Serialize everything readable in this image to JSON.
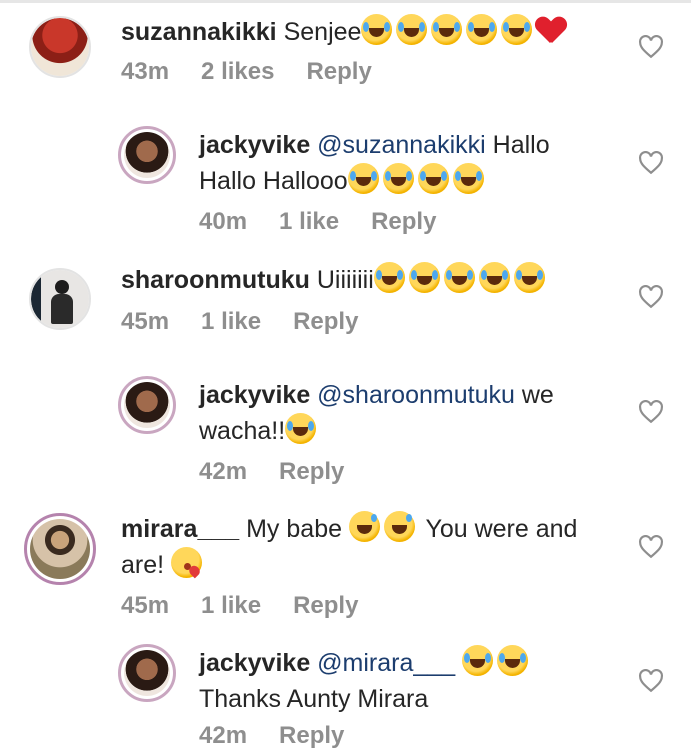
{
  "comments": [
    {
      "username": "suzannakikki",
      "text": "Senjee",
      "emoji": [
        "face-with-tears-of-joy",
        "face-with-tears-of-joy",
        "face-with-tears-of-joy",
        "face-with-tears-of-joy",
        "face-with-tears-of-joy",
        "red-heart"
      ],
      "time": "43m",
      "likes": "2 likes",
      "reply": "Reply"
    },
    {
      "username": "jackyvike",
      "mention": "@suzannakikki",
      "text": "Hallo Hallo Hallooo",
      "emoji": [
        "face-with-tears-of-joy",
        "face-with-tears-of-joy",
        "face-with-tears-of-joy",
        "face-with-tears-of-joy"
      ],
      "time": "40m",
      "likes": "1 like",
      "reply": "Reply"
    },
    {
      "username": "sharoonmutuku",
      "text": "Uiiiiiii",
      "emoji": [
        "face-with-tears-of-joy",
        "face-with-tears-of-joy",
        "face-with-tears-of-joy",
        "face-with-tears-of-joy",
        "face-with-tears-of-joy"
      ],
      "time": "45m",
      "likes": "1 like",
      "reply": "Reply"
    },
    {
      "username": "jackyvike",
      "mention": "@sharoonmutuku",
      "text_a": "we",
      "text_b": "wacha!!",
      "emoji": [
        "face-with-tears-of-joy"
      ],
      "time": "42m",
      "reply": "Reply"
    },
    {
      "username": "mirara___",
      "text_a": "My babe",
      "text_b": "You were and",
      "text_c": "are!",
      "emoji": [
        "grinning-face-with-sweat",
        "grinning-face-with-sweat",
        "face-blowing-a-kiss"
      ],
      "time": "45m",
      "likes": "1 like",
      "reply": "Reply"
    },
    {
      "username": "jackyvike",
      "mention": "@mirara___",
      "text": "Thanks Aunty Mirara",
      "emoji": [
        "face-with-tears-of-joy",
        "face-with-tears-of-joy"
      ],
      "time": "42m",
      "reply": "Reply"
    }
  ],
  "icons": {
    "like": "heart-outline-icon"
  },
  "colors": {
    "mention": "#1c3d6e",
    "meta": "#8e8e8e",
    "text": "#262626"
  }
}
